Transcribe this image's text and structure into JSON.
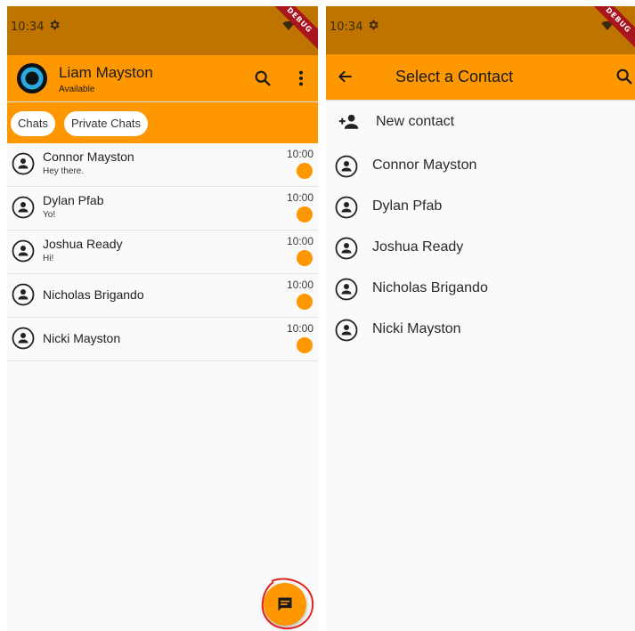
{
  "colors": {
    "primary": "#ff9800",
    "status_bar": "#bf7400",
    "debug_ribbon": "#a8151d"
  },
  "status_bar": {
    "time": "10:34",
    "debug_label": "DEBUG"
  },
  "left_screen": {
    "user": {
      "name": "Liam Mayston",
      "status": "Available"
    },
    "tabs": [
      "Chats",
      "Private Chats"
    ],
    "chats": [
      {
        "name": "Connor Mayston",
        "message": "Hey there.",
        "time": "10:00"
      },
      {
        "name": "Dylan Pfab",
        "message": "Yo!",
        "time": "10:00"
      },
      {
        "name": "Joshua Ready",
        "message": "Hi!",
        "time": "10:00"
      },
      {
        "name": "Nicholas Brigando",
        "message": "",
        "time": "10:00"
      },
      {
        "name": "Nicki Mayston",
        "message": "",
        "time": "10:00"
      }
    ],
    "icons": {
      "search": "search-icon",
      "more": "more-vert-icon",
      "fab": "message-icon"
    }
  },
  "right_screen": {
    "title": "Select a Contact",
    "new_contact_label": "New contact",
    "contacts": [
      "Connor Mayston",
      "Dylan Pfab",
      "Joshua Ready",
      "Nicholas Brigando",
      "Nicki Mayston"
    ],
    "icons": {
      "back": "arrow-back-icon",
      "search": "search-icon",
      "add_person": "person-add-icon"
    }
  }
}
